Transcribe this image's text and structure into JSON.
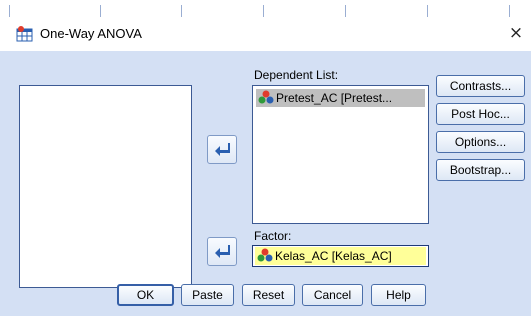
{
  "window": {
    "title": "One-Way ANOVA",
    "close_glyph": "×"
  },
  "icons": {
    "app": "anova-app-icon",
    "close": "close-icon",
    "variable": "nominal-variable-icon",
    "move": "move-arrow-icon"
  },
  "dependent_list": {
    "label": "Dependent List:",
    "items": [
      {
        "label": "Pretest_AC [Pretest..."
      }
    ]
  },
  "factor": {
    "label": "Factor:",
    "value": "Kelas_AC [Kelas_AC]"
  },
  "side_buttons": [
    {
      "label": "Contrasts..."
    },
    {
      "label": "Post Hoc..."
    },
    {
      "label": "Options..."
    },
    {
      "label": "Bootstrap..."
    }
  ],
  "bottom_buttons": [
    {
      "label": "OK"
    },
    {
      "label": "Paste"
    },
    {
      "label": "Reset"
    },
    {
      "label": "Cancel"
    },
    {
      "label": "Help"
    }
  ],
  "colors": {
    "dialog_bg": "#d4e0f4",
    "selected_item": "#bfbfbf",
    "factor_highlight": "#ffff99",
    "arrow_blue": "#2a5fb0"
  }
}
